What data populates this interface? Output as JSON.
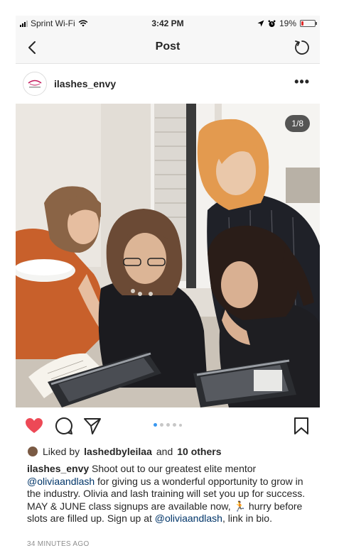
{
  "status_bar": {
    "carrier": "Sprint Wi-Fi",
    "time": "3:42 PM",
    "battery": "19%",
    "battery_level": 0.19
  },
  "nav": {
    "title": "Post"
  },
  "post": {
    "username": "ilashes_envy",
    "more_label": "•••",
    "photo_counter": "1/8",
    "carousel_total": 8,
    "carousel_index": 1
  },
  "likes": {
    "prefix": "Liked by",
    "user": "lashedbyleilaa",
    "joiner": "and",
    "others": "10 others"
  },
  "caption": {
    "username": "ilashes_envy",
    "part1": " Shoot out to our greatest elite mentor ",
    "mention1": "@oliviaandlash",
    "part2": " for giving us a wonderful opportunity to grow in the industry. Olivia and lash training will set you up for success. MAY & JUNE class signups are available now, ",
    "emoji": "🏃",
    "part3": " hurry before slots are filled up. Sign up at ",
    "mention2": "@oliviaandlash",
    "part4": ", link in bio."
  },
  "timestamp": "34 MINUTES AGO",
  "colors": {
    "like_red": "#ed4956",
    "mention_blue": "#003569",
    "dot_active": "#3897f0"
  },
  "icons": [
    "back-arrow-icon",
    "refresh-icon",
    "heart-icon",
    "comment-icon",
    "share-icon",
    "bookmark-icon",
    "more-icon"
  ]
}
